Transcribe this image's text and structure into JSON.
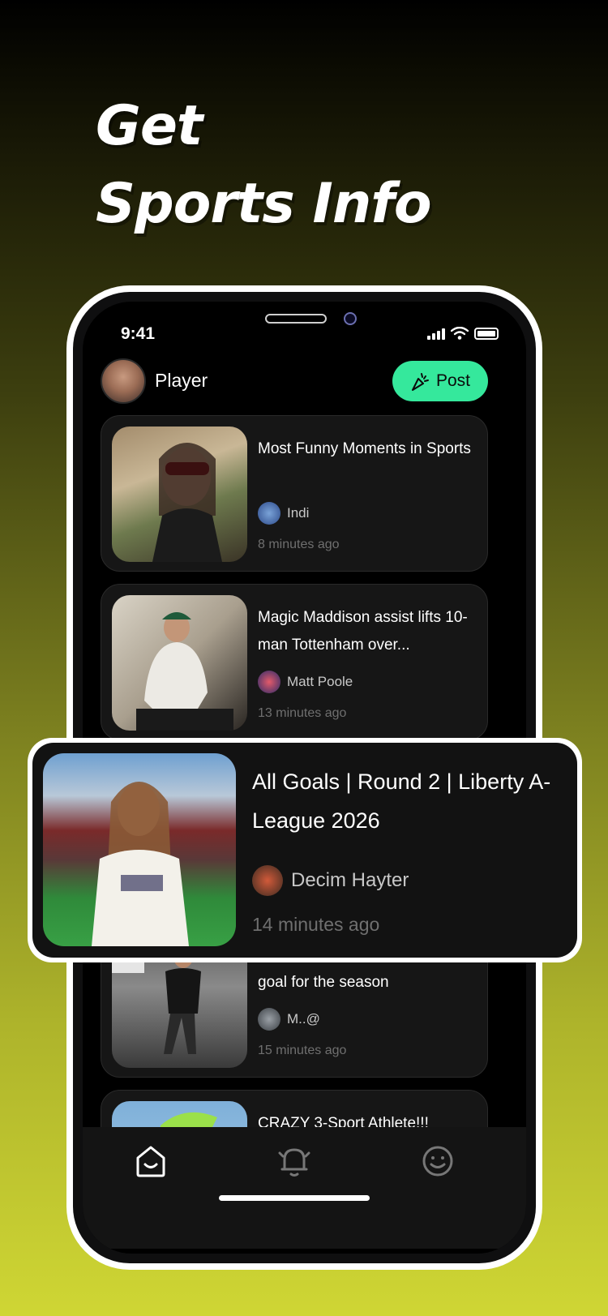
{
  "headline": {
    "line1": "Get",
    "line2": "Sports Info"
  },
  "status_bar": {
    "time": "9:41"
  },
  "header": {
    "user_name": "Player",
    "post_label": "Post"
  },
  "feed": [
    {
      "title": "Most Funny Moments in Sports",
      "author": "Indi",
      "time": "8 minutes ago"
    },
    {
      "title": "Magic Maddison assist lifts 10-man Tottenham over...",
      "author": "Matt Poole",
      "time": "13 minutes ago"
    },
    {
      "title": "Patrick Yazbek bags second goal for the season",
      "author": "M..@",
      "time": "15 minutes ago"
    },
    {
      "title": "CRAZY 3-Sport Athlete!!!",
      "author": "",
      "time": ""
    }
  ],
  "featured": {
    "title": "All Goals | Round 2 | Liberty A-League 2026",
    "author": "Decim Hayter",
    "time": "14 minutes ago"
  },
  "tabs": [
    {
      "icon": "home-icon"
    },
    {
      "icon": "bell-icon"
    },
    {
      "icon": "smiley-icon"
    }
  ],
  "colors": {
    "accent": "#35e89c",
    "card_bg": "#161616"
  }
}
